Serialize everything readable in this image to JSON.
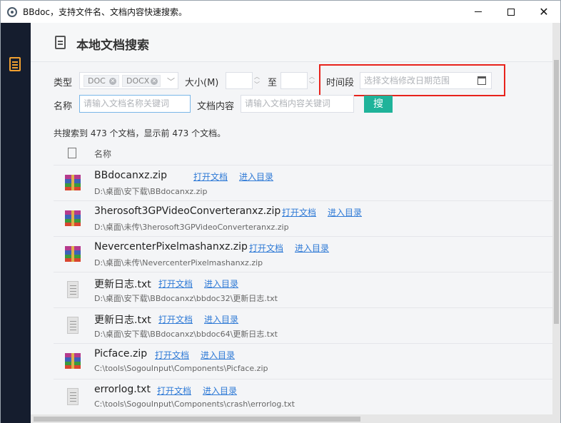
{
  "window": {
    "title": "BBdoc，支持文件名、文档内容快速搜索。",
    "minimize_icon": "minimize-icon",
    "maximize_icon": "maximize-icon",
    "close_glyph": "✕"
  },
  "sidebar": {
    "items": [
      {
        "icon": "document-icon",
        "active": true
      }
    ]
  },
  "header": {
    "title": "本地文档搜索",
    "icon": "document-icon"
  },
  "filters": {
    "type_label": "类型",
    "types_selected": [
      "DOC",
      "DOCX"
    ],
    "size_label": "大小(M)",
    "size_to_label": "至",
    "size_min": "",
    "size_max": "",
    "time_label": "时间段",
    "date_placeholder": "选择文档修改日期范围",
    "name_label": "名称",
    "name_placeholder": "请输入文档名称关键词",
    "content_label": "文档内容",
    "content_placeholder": "请输入文档内容关键词",
    "search_button": "搜"
  },
  "results": {
    "summary": "共搜索到 473 个文档，显示前 473 个文档。",
    "column_name": "名称",
    "open_label": "打开文档",
    "dir_label": "进入目录",
    "rows": [
      {
        "name": "BBdocanxz.zip",
        "path": "D:\\桌面\\安下载\\BBdocanxz.zip",
        "icon": "zip"
      },
      {
        "name": "3herosoft3GPVideoConverteranxz.zip",
        "path": "D:\\桌面\\未传\\3herosoft3GPVideoConverteranxz.zip",
        "icon": "zip"
      },
      {
        "name": "NevercenterPixelmashanxz.zip",
        "path": "D:\\桌面\\未传\\NevercenterPixelmashanxz.zip",
        "icon": "zip"
      },
      {
        "name": "更新日志.txt",
        "path": "D:\\桌面\\安下载\\BBdocanxz\\bbdoc32\\更新日志.txt",
        "icon": "txt"
      },
      {
        "name": "更新日志.txt",
        "path": "D:\\桌面\\安下载\\BBdocanxz\\bbdoc64\\更新日志.txt",
        "icon": "txt"
      },
      {
        "name": "Picface.zip",
        "path": "C:\\tools\\SogouInput\\Components\\Picface.zip",
        "icon": "zip"
      },
      {
        "name": "errorlog.txt",
        "path": "C:\\tools\\SogouInput\\Components\\crash\\errorlog.txt",
        "icon": "txt"
      }
    ]
  },
  "annotation_color": "#e8231c",
  "accent_color": "#1fb39a"
}
